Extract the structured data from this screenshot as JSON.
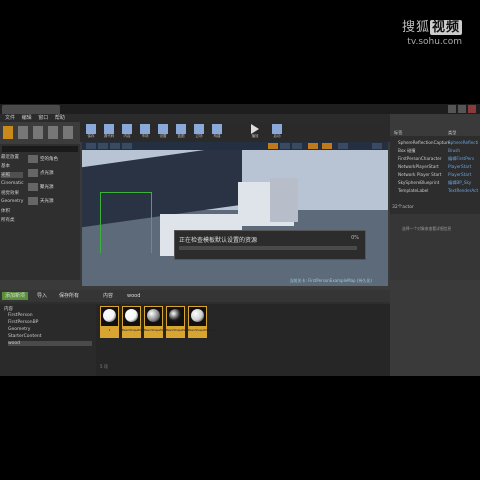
{
  "watermark": {
    "brand": "搜狐",
    "brand_badge": "视频",
    "url": "tv.sohu.com"
  },
  "menu": [
    "文件",
    "编辑",
    "窗口",
    "帮助"
  ],
  "modes": {
    "categories": [
      "最近放置",
      "基本",
      "光照",
      "Cinematic",
      "视觉效果",
      "Geometry",
      "体积",
      "所有类"
    ],
    "items": [
      "空的角色",
      "点光源",
      "聚光源",
      "天光源"
    ]
  },
  "toolbar": {
    "buttons": [
      "保存",
      "源代码",
      "内容",
      "市场",
      "设置",
      "蓝图",
      "过场",
      "构建",
      "播放",
      "启动"
    ]
  },
  "viewport": {
    "loading_text": "正在检查模板默认设置的资源",
    "progress_label": "0%",
    "progress": 0,
    "caption": "当前关卡: FirstPersonExampleMap (持久化)"
  },
  "outliner": {
    "header_label": "标签",
    "type_header": "类型",
    "rows": [
      {
        "name": "SphereReflectionCapture",
        "type": "SphereReflectionCapture"
      },
      {
        "name": "Box 碰撞",
        "type": "Brush"
      },
      {
        "name": "FirstPersonCharacter",
        "type": "编辑FirstPers"
      },
      {
        "name": "NetworkPlayerStart",
        "type": "PlayerStart"
      },
      {
        "name": "Network Player Start",
        "type": "PlayerStart"
      },
      {
        "name": "SkySphereBlueprint",
        "type": "编辑BP_Sky"
      },
      {
        "name": "TemplateLabel",
        "type": "TextRenderActor"
      }
    ],
    "count": "32个actor"
  },
  "details": {
    "hint": "选择一个对象来查看详细信息"
  },
  "content_browser": {
    "add_new": "添加新项",
    "import": "导入",
    "save_all": "保存所有",
    "path": [
      "内容",
      "wood"
    ],
    "tree": [
      "内容",
      "FirstPerson",
      "FirstPersonBP",
      "Geometry",
      "StarterContent",
      "wood"
    ],
    "assets": [
      {
        "label": "1",
        "color": "#f2f2f2"
      },
      {
        "label": "BasicShapeMaterial",
        "color": "#f5f5f5"
      },
      {
        "label": "BasicShapeMaterial",
        "color": "#8c8c8c"
      },
      {
        "label": "BasicShapeMaterial_1",
        "color": "#1c1c1c"
      },
      {
        "label": "BasicShapeMaterial",
        "color": "#cfcfcf"
      }
    ],
    "status": "5 项"
  }
}
